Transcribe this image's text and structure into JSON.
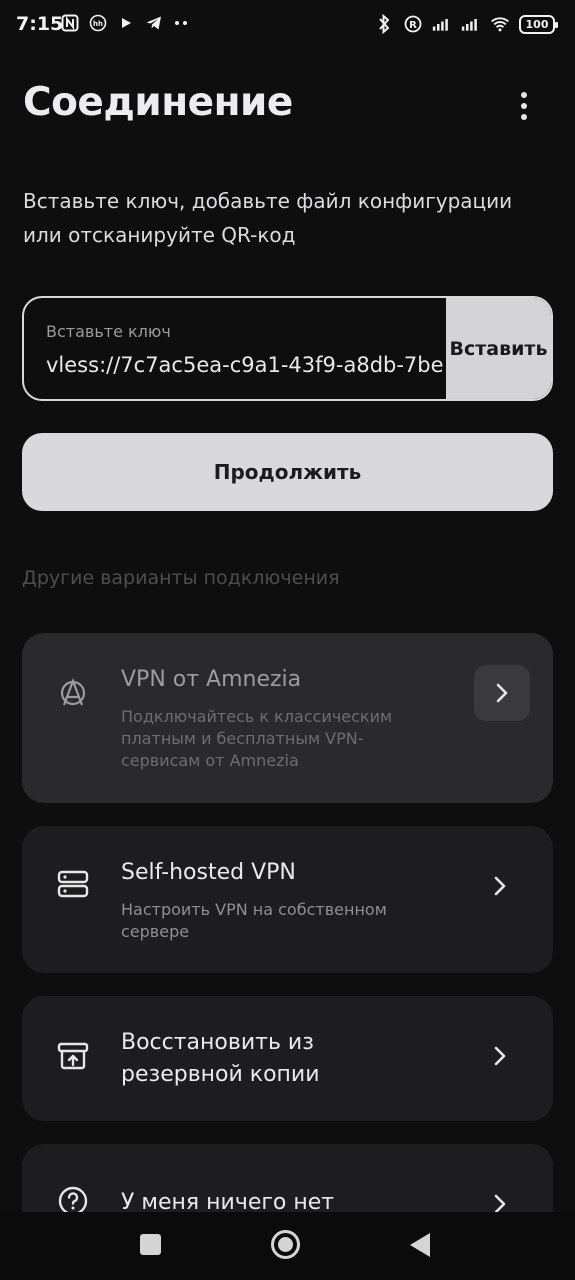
{
  "status_bar": {
    "time": "7:15",
    "battery": "100",
    "left_icons": [
      "nfc-icon",
      "hh-app-icon",
      "play-icon",
      "telegram-icon",
      "more-dots-icon"
    ],
    "right_icons": [
      "bluetooth-icon",
      "registered-icon",
      "signal-icon",
      "signal-icon",
      "wifi-icon"
    ]
  },
  "header": {
    "title": "Соединение",
    "menu_icon": "more-vertical-icon"
  },
  "subtitle": "Вставьте ключ, добавьте файл конфигурации или отсканируйте QR-код",
  "key_input": {
    "label": "Вставьте ключ",
    "value": "vless://7c7ac5ea-c9a1-43f9-a8db-7be",
    "paste_label": "Вставить"
  },
  "continue_label": "Продолжить",
  "section_label": "Другие варианты подключения",
  "options": [
    {
      "title": "VPN от Amnezia",
      "description": "Подключайтесь к классическим платным и бесплатным VPN-сервисам от Amnezia",
      "icon": "amnezia-logo-icon"
    },
    {
      "title": "Self-hosted VPN",
      "description": "Настроить VPN на собственном сервере",
      "icon": "server-icon"
    },
    {
      "title": "Восстановить из резервной копии",
      "description": "",
      "icon": "archive-restore-icon"
    },
    {
      "title": "У меня ничего нет",
      "description": "",
      "icon": "help-circle-icon"
    }
  ],
  "colors": {
    "background": "#0e0e0f",
    "card": "#1d1d1f",
    "card_active": "#2a2a2c",
    "button": "#d9d9db",
    "muted_text": "#4d4d52"
  }
}
